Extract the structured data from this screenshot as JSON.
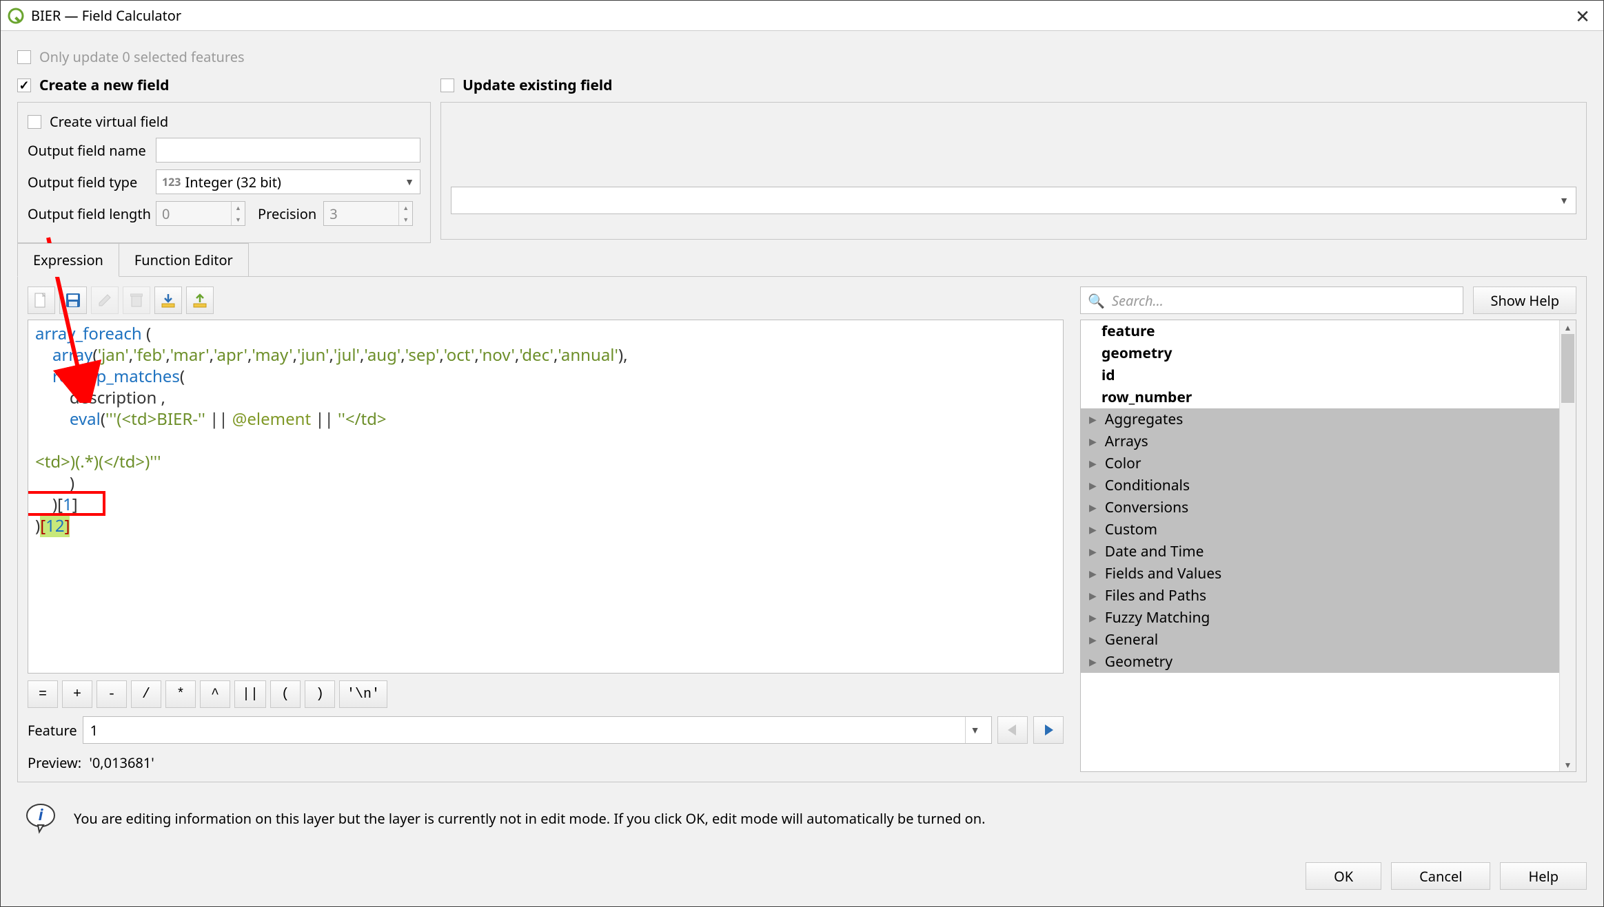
{
  "window": {
    "title": "BIER — Field Calculator"
  },
  "top": {
    "only_update_label": "Only update 0 selected features"
  },
  "create_field": {
    "heading": "Create a new field",
    "virtual_label": "Create virtual field",
    "output_name_label": "Output field name",
    "output_name_value": "",
    "output_type_label": "Output field type",
    "output_type_value": "Integer (32 bit)",
    "output_type_prefix": "123",
    "output_length_label": "Output field length",
    "output_length_value": "0",
    "precision_label": "Precision",
    "precision_value": "3"
  },
  "update_field": {
    "heading": "Update existing field",
    "combo_value": ""
  },
  "tabs": {
    "expression": "Expression",
    "function_editor": "Function Editor"
  },
  "expression": {
    "code_tokens": {
      "l1a": "array_foreach",
      "l1b": " (",
      "l2a": "    ",
      "l2b": "array",
      "l2c": "(",
      "l2d": "'jan'",
      "l2e": ",",
      "l2f": "'feb'",
      "l2g": ",",
      "l2h": "'mar'",
      "l2i": ",",
      "l2j": "'apr'",
      "l2k": ",",
      "l2l": "'may'",
      "l2m": ",",
      "l2n": "'jun'",
      "l2o": ",",
      "l2p": "'jul'",
      "l2q": ",",
      "l2r": "'aug'",
      "l2s": ",",
      "l2t": "'sep'",
      "l2u": ",",
      "l2v": "'oct'",
      "l2w": ",",
      "l2x": "'nov'",
      "l2y": ",",
      "l2z": "'dec'",
      "l2aa": ",",
      "l2ab": "'annual'",
      "l2ac": "),",
      "l3a": "    ",
      "l3b": "regexp_matches",
      "l3c": "(",
      "l4a": "        description ,",
      "l5a": "        ",
      "l5b": "eval",
      "l5c": "(",
      "l5d": "'''(<td>BIER-''",
      "l5e": " || ",
      "l5f": "@element",
      "l5g": " || ",
      "l5h": "''</td>",
      "l6a": "",
      "l7a": "<td>)(.*)(</td>)'''",
      "l8a": "        )",
      "l9a": "    )[",
      "l9b": "1",
      "l9c": "]",
      "l10a": ")",
      "l10b": "[",
      "l10c": "12",
      "l10d": "]"
    },
    "ops": [
      "=",
      "+",
      "-",
      "/",
      "*",
      "^",
      "||",
      "(",
      ")",
      "'\\n'"
    ],
    "feature_label": "Feature",
    "feature_value": "1",
    "preview_label": "Preview:",
    "preview_value": "'0,013681'"
  },
  "search": {
    "placeholder": "Search…",
    "show_help": "Show Help"
  },
  "tree": {
    "top_items": [
      "feature",
      "geometry",
      "id",
      "row_number"
    ],
    "categories": [
      "Aggregates",
      "Arrays",
      "Color",
      "Conditionals",
      "Conversions",
      "Custom",
      "Date and Time",
      "Fields and Values",
      "Files and Paths",
      "Fuzzy Matching",
      "General",
      "Geometry"
    ]
  },
  "info": {
    "text": "You are editing information on this layer but the layer is currently not in edit mode. If you click OK, edit mode will automatically be turned on."
  },
  "footer": {
    "ok": "OK",
    "cancel": "Cancel",
    "help": "Help"
  }
}
